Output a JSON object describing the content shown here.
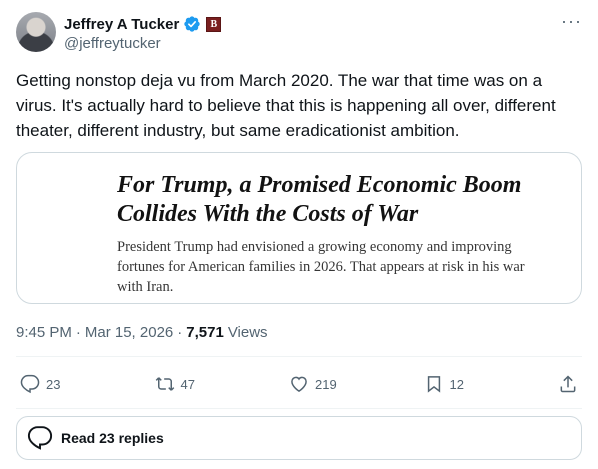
{
  "author": {
    "display_name": "Jeffrey A Tucker",
    "handle": "@jeffreytucker",
    "affiliate_badge": "B"
  },
  "tweet": {
    "text": "Getting nonstop deja vu from March 2020. The war that time was on a virus. It's actually hard to believe that this is happening all over, different theater, different industry, but same eradicationist ambition."
  },
  "card": {
    "headline": "For Trump, a Promised Economic Boom Collides With the Costs of War",
    "summary": "President Trump had envisioned a growing economy and improving fortunes for American families in 2026. That appears at risk in his war with Iran."
  },
  "meta": {
    "time": "9:45 PM",
    "separator": "·",
    "date": "Mar 15, 2026",
    "views_count": "7,571",
    "views_label": "Views"
  },
  "actions": {
    "replies": "23",
    "reposts": "47",
    "likes": "219",
    "bookmarks": "12"
  },
  "read_replies": "Read 23 replies",
  "colors": {
    "text": "#0f1419",
    "secondary": "#536471",
    "verified": "#1d9bf0",
    "border": "#cfd9de"
  }
}
